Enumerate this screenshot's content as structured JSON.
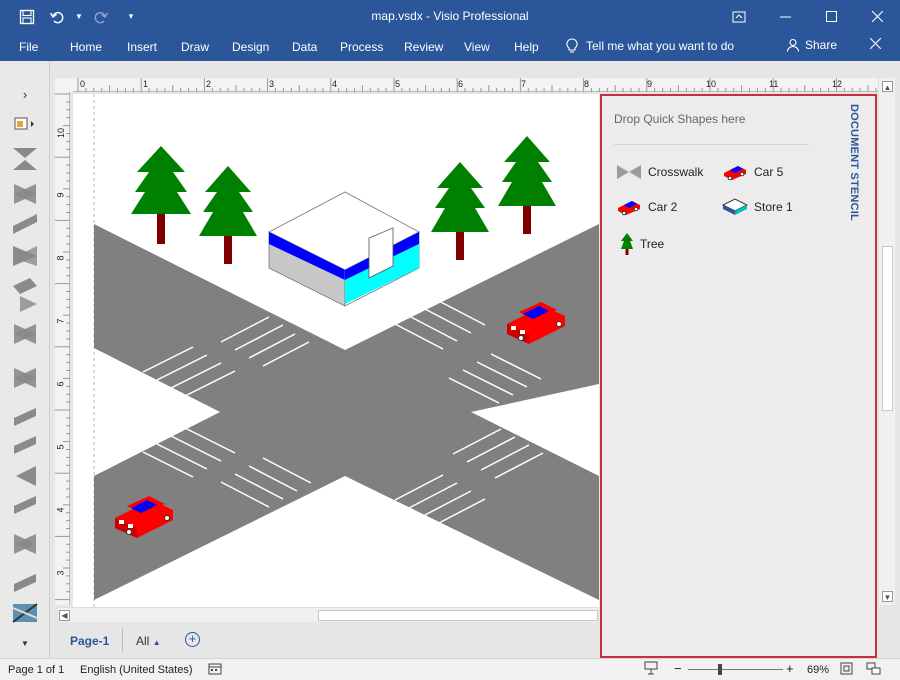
{
  "window": {
    "title": "map.vsdx - Visio Professional"
  },
  "qat": {
    "save_icon": "save-icon",
    "undo_icon": "undo-icon",
    "redo_icon": "redo-icon",
    "customize_icon": "customize-qat-icon"
  },
  "ribbon": {
    "tabs": [
      "File",
      "Home",
      "Insert",
      "Draw",
      "Design",
      "Data",
      "Process",
      "Review",
      "View",
      "Help"
    ],
    "tell_me": "Tell me what you want to do",
    "share": "Share"
  },
  "rulers": {
    "top": [
      "0",
      "1",
      "2",
      "3",
      "4",
      "5",
      "6",
      "7",
      "8",
      "9",
      "10",
      "11",
      "12"
    ],
    "left": [
      "10",
      "9",
      "8",
      "7",
      "6",
      "5",
      "4",
      "3"
    ]
  },
  "stencil": {
    "title": "DOCUMENT STENCIL",
    "drop_hint": "Drop Quick Shapes here",
    "items": [
      {
        "label": "Crosswalk",
        "icon": "crosswalk-icon"
      },
      {
        "label": "Car 5",
        "icon": "car-icon"
      },
      {
        "label": "Car 2",
        "icon": "car-icon"
      },
      {
        "label": "Store 1",
        "icon": "store-icon"
      },
      {
        "label": "Tree",
        "icon": "tree-icon"
      }
    ]
  },
  "page_tabs": {
    "current": "Page-1",
    "all": "All"
  },
  "status": {
    "page": "Page 1 of 1",
    "language": "English (United States)",
    "zoom": "69%"
  },
  "colors": {
    "accent": "#2b579a",
    "road": "#808080",
    "tree": "#008000",
    "trunk": "#800000",
    "car": "#ff0000",
    "store_band": "#0000ff",
    "store_glass": "#00ffff",
    "stencil_border": "#c2323d"
  }
}
